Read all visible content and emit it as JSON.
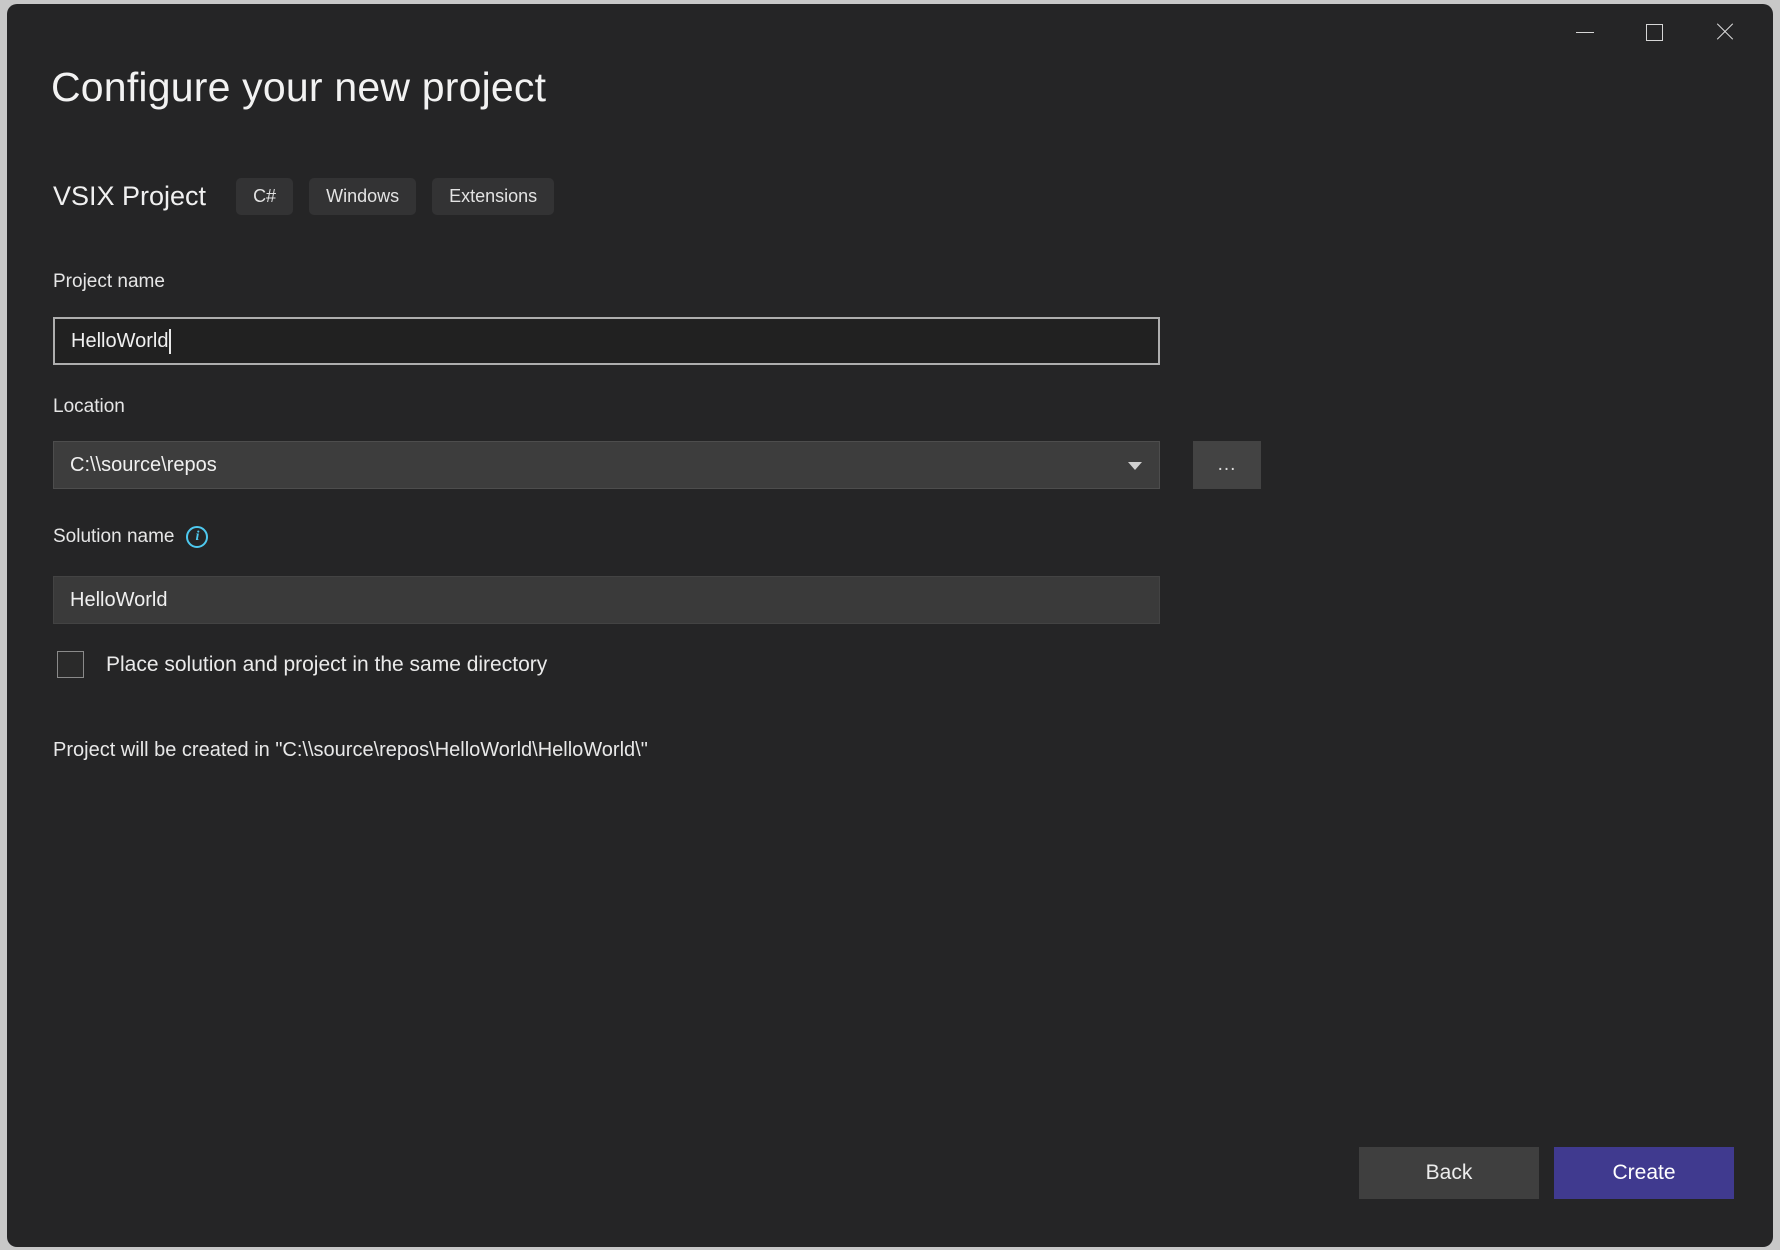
{
  "window": {
    "controls": {
      "minimize_label": "Minimize",
      "maximize_label": "Maximize",
      "close_label": "Close"
    }
  },
  "header": {
    "title": "Configure your new project",
    "template_name": "VSIX Project",
    "tags": [
      {
        "label": "C#"
      },
      {
        "label": "Windows"
      },
      {
        "label": "Extensions"
      }
    ]
  },
  "form": {
    "project_name": {
      "label": "Project name",
      "value": "HelloWorld"
    },
    "location": {
      "label": "Location",
      "value": "C:\\\\source\\repos",
      "browse_label": "..."
    },
    "solution_name": {
      "label": "Solution name",
      "info_icon": "info-icon",
      "info_glyph": "i",
      "value": "HelloWorld"
    },
    "same_directory_checkbox": {
      "label": "Place solution and project in the same directory",
      "checked": false
    },
    "creation_path_note": "Project will be created in \"C:\\\\source\\repos\\HelloWorld\\HelloWorld\\\""
  },
  "footer": {
    "back_label": "Back",
    "create_label": "Create"
  },
  "colors": {
    "window_background": "#252526",
    "accent_primary": "#403a8f",
    "info_icon": "#4ec9ef",
    "field_background": "#3a3a3a",
    "focused_field_border": "#aeaeae"
  }
}
